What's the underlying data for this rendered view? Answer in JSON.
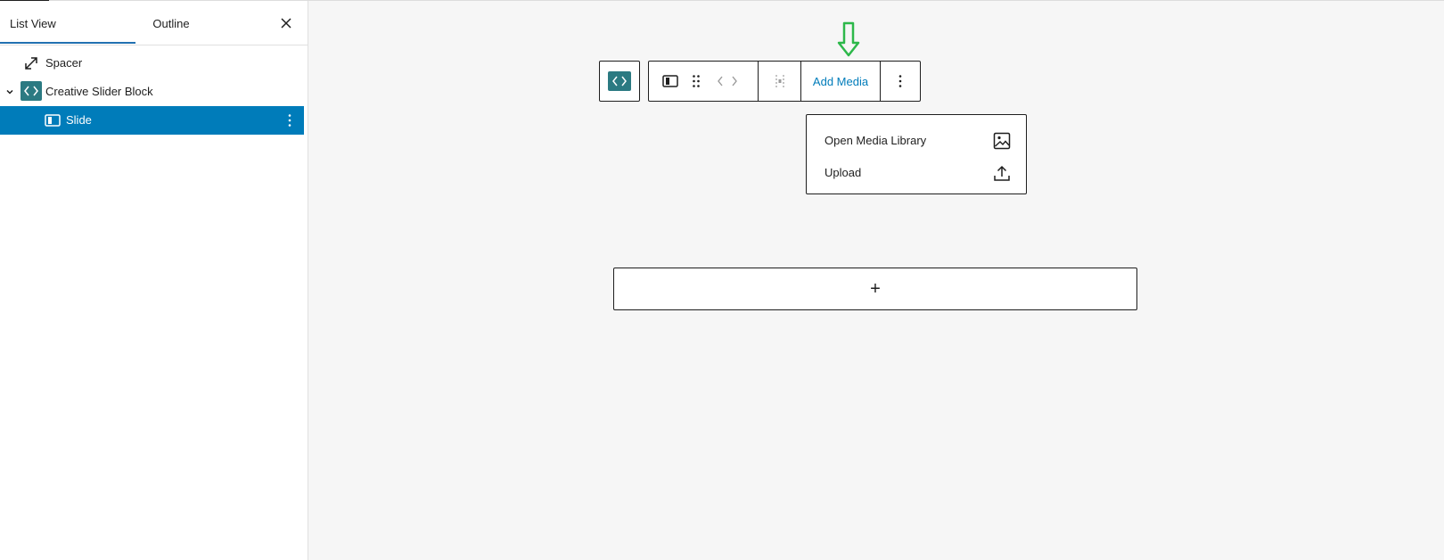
{
  "sidebar": {
    "tabs": [
      {
        "label": "List View"
      },
      {
        "label": "Outline"
      }
    ],
    "close_icon": "close-icon",
    "items": [
      {
        "label": "Spacer",
        "icon": "spacer-resize-icon"
      },
      {
        "label": "Creative Slider Block",
        "icon": "code-brackets-icon",
        "expanded": true
      },
      {
        "label": "Slide",
        "icon": "slide-column-icon",
        "selected": true
      }
    ]
  },
  "toolbar": {
    "add_media_label": "Add Media",
    "icons": [
      "code-brackets-icon",
      "slide-column-icon",
      "drag-handle-icon",
      "move-arrows-icon",
      "align-icon",
      "more-options-icon"
    ]
  },
  "media_menu": {
    "items": [
      {
        "label": "Open Media Library",
        "icon": "image-icon"
      },
      {
        "label": "Upload",
        "icon": "upload-icon"
      }
    ]
  },
  "appender": {
    "symbol": "+"
  },
  "colors": {
    "accent": "#007cba",
    "block_icon": "#2b7a82",
    "annotation_arrow": "#2db84a",
    "canvas": "#f6f6f6"
  }
}
